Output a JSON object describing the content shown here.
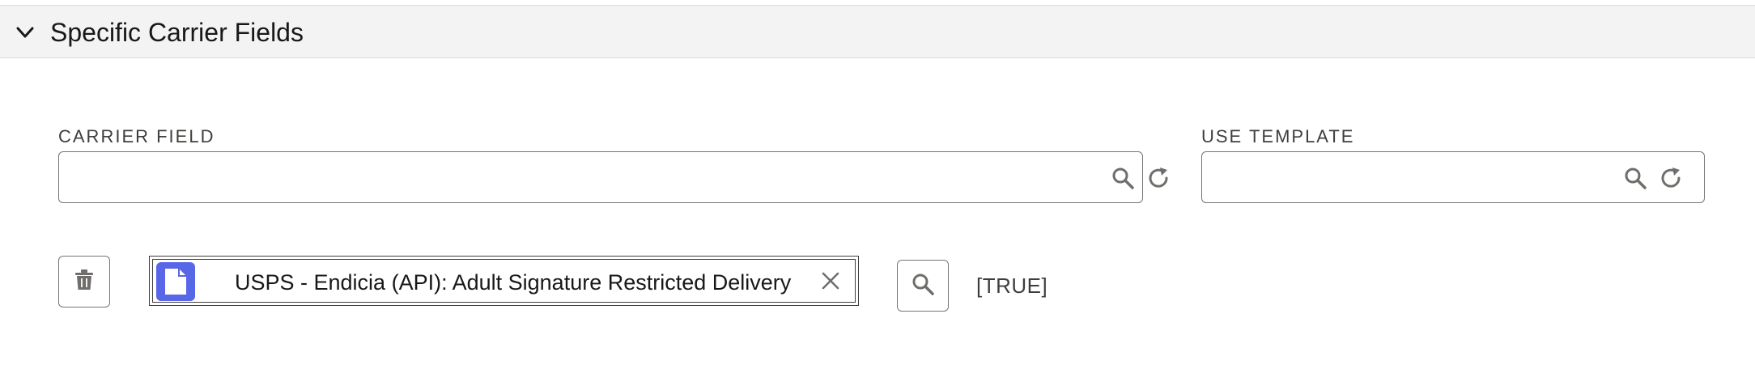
{
  "section": {
    "title": "Specific Carrier Fields",
    "toggle_icon": "chevron-down-icon"
  },
  "carrier_field": {
    "label": "CARRIER FIELD",
    "value": "",
    "placeholder": "",
    "search_icon": "search-icon",
    "refresh_icon": "refresh-icon"
  },
  "use_template": {
    "label": "USE TEMPLATE",
    "value": "",
    "placeholder": "",
    "search_icon": "search-icon",
    "refresh_icon": "refresh-icon"
  },
  "row": {
    "delete_icon": "trash-icon",
    "selected_pill": {
      "icon": "document-icon",
      "label": "USPS - Endicia (API): Adult Signature Restricted Delivery",
      "remove_icon": "close-icon"
    },
    "search_icon": "search-icon",
    "value": "[TRUE]"
  },
  "colors": {
    "header_bg": "#f3f3f3",
    "border": "#747474",
    "pill_icon_bg": "#5867e8",
    "icon_gray": "#706e6b"
  }
}
